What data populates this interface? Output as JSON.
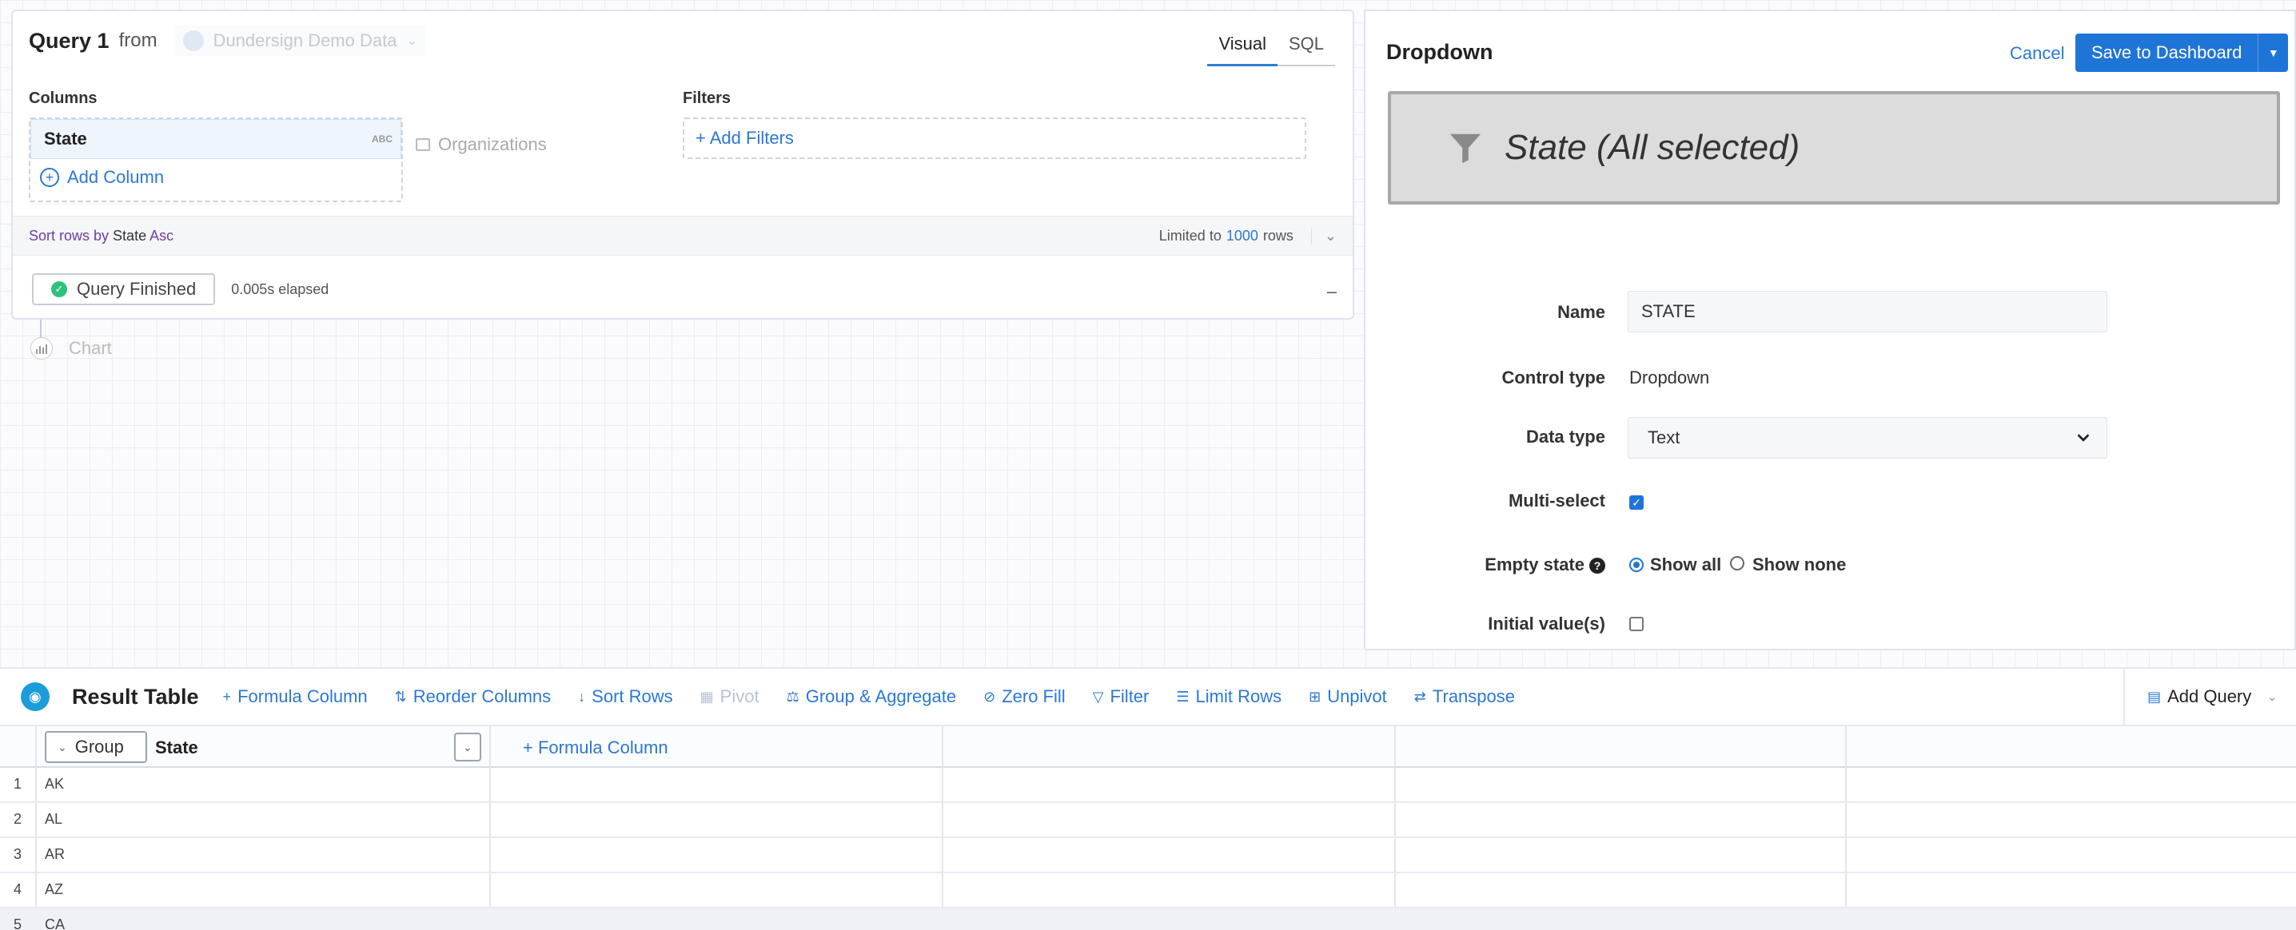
{
  "query": {
    "title": "Query 1",
    "from_label": "from",
    "source": "Dundersign Demo Data",
    "tabs": [
      {
        "label": "Visual",
        "active": true
      },
      {
        "label": "SQL",
        "active": false
      }
    ],
    "columns_label": "Columns",
    "filters_label": "Filters",
    "column_name": "State",
    "column_type_badge": "ABC",
    "add_column": "Add Column",
    "table_name": "Organizations",
    "add_filters": "+ Add Filters",
    "sort": {
      "prefix": "Sort rows by",
      "column": "State",
      "direction": "Asc"
    },
    "limit": {
      "prefix": "Limited to",
      "value": "1000",
      "suffix": "rows"
    },
    "status": "Query Finished",
    "elapsed": "0.005s elapsed",
    "collapse": "–"
  },
  "chart_node": {
    "label": "Chart"
  },
  "panel": {
    "title": "Dropdown",
    "cancel": "Cancel",
    "save": "Save to Dashboard",
    "preview_text": "State (All selected)",
    "fields": {
      "name_label": "Name",
      "name_value": "STATE",
      "control_type_label": "Control type",
      "control_type_value": "Dropdown",
      "data_type_label": "Data type",
      "data_type_value": "Text",
      "multi_select_label": "Multi-select",
      "multi_select_checked": true,
      "empty_state_label": "Empty state",
      "empty_state_options": [
        "Show all",
        "Show none"
      ],
      "empty_state_selected": "Show all",
      "initial_values_label": "Initial value(s)",
      "initial_values_checked": false
    }
  },
  "result_table": {
    "title": "Result Table",
    "toolbar": [
      {
        "icon": "+",
        "label": "Formula Column",
        "disabled": false
      },
      {
        "icon": "⇅",
        "label": "Reorder Columns",
        "disabled": false
      },
      {
        "icon": "↓",
        "label": "Sort Rows",
        "disabled": false
      },
      {
        "icon": "▦",
        "label": "Pivot",
        "disabled": true
      },
      {
        "icon": "⚖",
        "label": "Group & Aggregate",
        "disabled": false
      },
      {
        "icon": "⊘",
        "label": "Zero Fill",
        "disabled": false
      },
      {
        "icon": "▽",
        "label": "Filter",
        "disabled": false
      },
      {
        "icon": "☰",
        "label": "Limit Rows",
        "disabled": false
      },
      {
        "icon": "⊞",
        "label": "Unpivot",
        "disabled": false
      },
      {
        "icon": "⇄",
        "label": "Transpose",
        "disabled": false
      }
    ],
    "add_query": "Add Query",
    "group_button": "Group",
    "column_header": "State",
    "formula_column": "+ Formula Column",
    "rows": [
      {
        "num": "1",
        "value": "AK"
      },
      {
        "num": "2",
        "value": "AL"
      },
      {
        "num": "3",
        "value": "AR"
      },
      {
        "num": "4",
        "value": "AZ"
      },
      {
        "num": "5",
        "value": "CA"
      }
    ]
  },
  "colors": {
    "accent": "#1f74d8",
    "link": "#2b78d3",
    "success": "#2fc27a"
  }
}
